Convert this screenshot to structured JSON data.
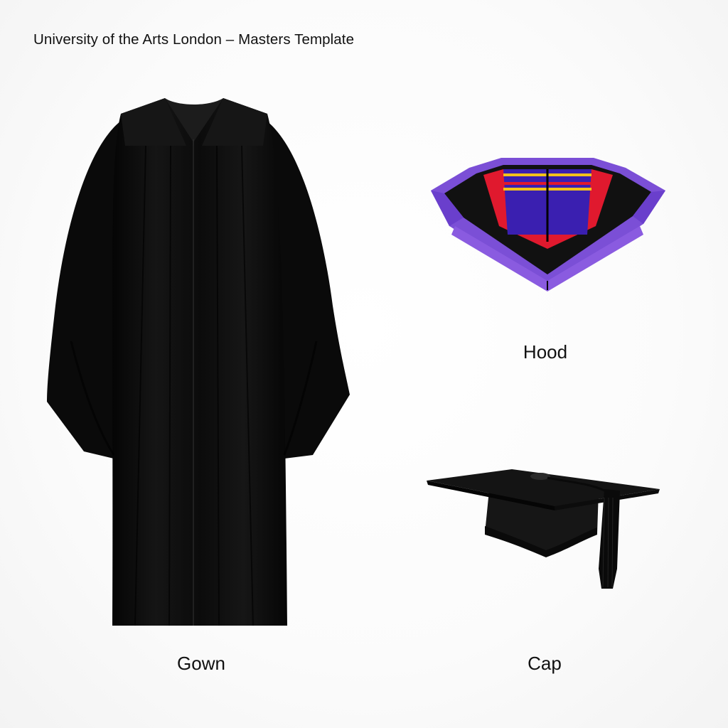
{
  "header": {
    "title": "University of the Arts London – Masters Template"
  },
  "items": {
    "gown": {
      "label": "Gown",
      "color": "#0d0d0d"
    },
    "hood": {
      "label": "Hood",
      "colors": {
        "outer_band": "#7b4fd6",
        "black_band": "#111111",
        "red_stripe": "#e0192e",
        "lining_blue": "#3a1fb0",
        "yellow_stripe": "#f2c21b"
      }
    },
    "cap": {
      "label": "Cap",
      "color": "#111111",
      "tassel": "#0a0a0a"
    }
  }
}
